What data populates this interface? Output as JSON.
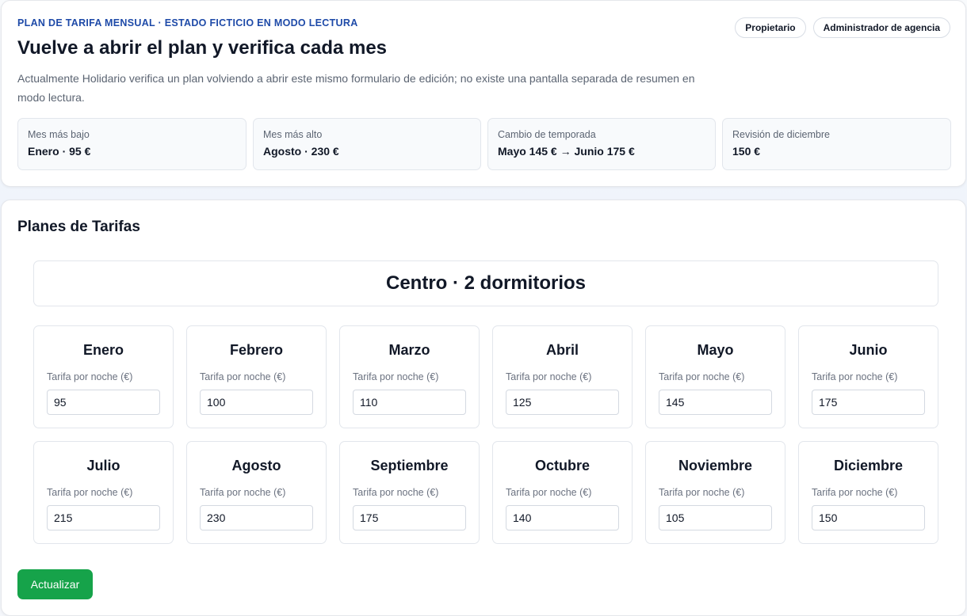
{
  "header": {
    "eyebrow": "PLAN DE TARIFA MENSUAL · ESTADO FICTICIO EN MODO LECTURA",
    "title": "Vuelve a abrir el plan y verifica cada mes",
    "description": "Actualmente Holidario verifica un plan volviendo a abrir este mismo formulario de edición; no existe una pantalla separada de resumen en modo lectura.",
    "roles": [
      "Propietario",
      "Administrador de agencia"
    ]
  },
  "stats": [
    {
      "label": "Mes más bajo",
      "value": "Enero · 95 €"
    },
    {
      "label": "Mes más alto",
      "value": "Agosto · 230 €"
    },
    {
      "label": "Cambio de temporada",
      "value": "Mayo 145 € → Junio 175 €"
    },
    {
      "label": "Revisión de diciembre",
      "value": "150 €"
    }
  ],
  "main": {
    "section_title": "Planes de Tarifas",
    "plan_name": "Centro · 2 dormitorios",
    "rate_label": "Tarifa por noche (€)",
    "months": [
      {
        "name": "Enero",
        "rate": "95"
      },
      {
        "name": "Febrero",
        "rate": "100"
      },
      {
        "name": "Marzo",
        "rate": "110"
      },
      {
        "name": "Abril",
        "rate": "125"
      },
      {
        "name": "Mayo",
        "rate": "145"
      },
      {
        "name": "Junio",
        "rate": "175"
      },
      {
        "name": "Julio",
        "rate": "215"
      },
      {
        "name": "Agosto",
        "rate": "230"
      },
      {
        "name": "Septiembre",
        "rate": "175"
      },
      {
        "name": "Octubre",
        "rate": "140"
      },
      {
        "name": "Noviembre",
        "rate": "105"
      },
      {
        "name": "Diciembre",
        "rate": "150"
      }
    ],
    "update_label": "Actualizar"
  },
  "colors": {
    "accent": "#1e4aa8",
    "button": "#16a34a"
  }
}
